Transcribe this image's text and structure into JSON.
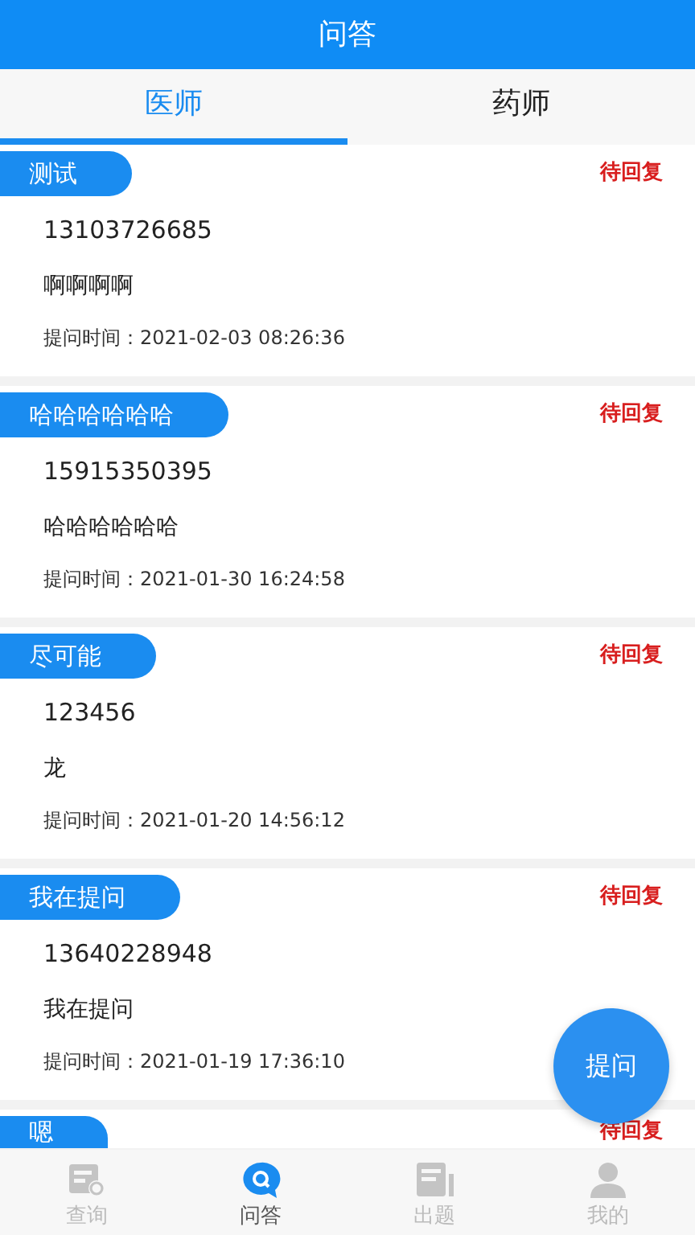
{
  "header": {
    "title": "问答"
  },
  "tabs": [
    {
      "label": "医师",
      "selected": true
    },
    {
      "label": "药师",
      "selected": false
    }
  ],
  "questions": [
    {
      "title": "测试",
      "status": "待回复",
      "phone": "13103726685",
      "content": "啊啊啊啊",
      "time": "提问时间：2021-02-03 08:26:36"
    },
    {
      "title": "哈哈哈哈哈哈",
      "status": "待回复",
      "phone": "15915350395",
      "content": "哈哈哈哈哈哈",
      "time": "提问时间：2021-01-30 16:24:58"
    },
    {
      "title": "尽可能",
      "status": "待回复",
      "phone": "123456",
      "content": "龙",
      "time": "提问时间：2021-01-20 14:56:12"
    },
    {
      "title": "我在提问",
      "status": "待回复",
      "phone": "13640228948",
      "content": "我在提问",
      "time": "提问时间：2021-01-19 17:36:10"
    },
    {
      "title": "嗯",
      "status": "待回复"
    }
  ],
  "ask_button": "提问",
  "bottom_nav": [
    {
      "label": "查询",
      "kind": "query",
      "selected": false
    },
    {
      "label": "问答",
      "kind": "qa",
      "selected": true
    },
    {
      "label": "出题",
      "kind": "exam",
      "selected": false
    },
    {
      "label": "我的",
      "kind": "mine",
      "selected": false
    }
  ]
}
